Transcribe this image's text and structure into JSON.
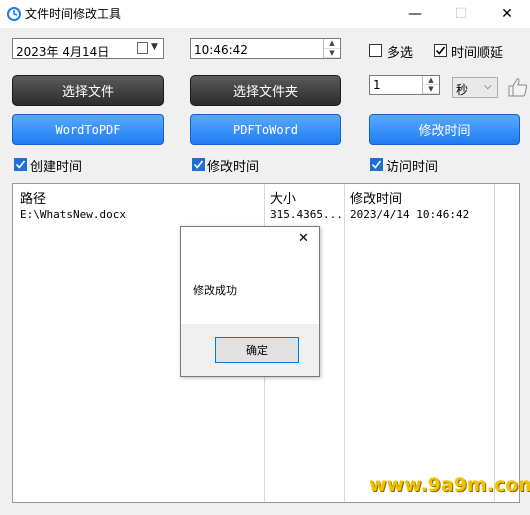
{
  "window": {
    "title": "文件时间修改工具",
    "minimize": "—",
    "maximize": "☐",
    "close": "✕"
  },
  "date_field": {
    "value": "2023年  4月14日"
  },
  "time_field": {
    "value": "10:46:42"
  },
  "options": {
    "multi_select": "多选",
    "time_order": "时间顺延"
  },
  "step": {
    "value": "1",
    "unit": "秒"
  },
  "buttons": {
    "select_file": "选择文件",
    "select_folder": "选择文件夹",
    "word_to_pdf": "WordToPDF",
    "pdf_to_word": "PDFToWord",
    "modify_time": "修改时间"
  },
  "checks": {
    "create_time": "创建时间",
    "modify_time": "修改时间",
    "access_time": "访问时间"
  },
  "table": {
    "headers": [
      "路径",
      "大小",
      "修改时间"
    ],
    "rows": [
      {
        "path": "E:\\WhatsNew.docx",
        "size": "315.4365...",
        "mtime": "2023/4/14 10:46:42"
      }
    ]
  },
  "dialog": {
    "message": "修改成功",
    "ok": "确定",
    "close": "✕"
  },
  "watermark": "www.9a9m.com",
  "colors": {
    "blue_button": "#1f7df2",
    "dark_button": "#2c2c2c",
    "checkbox_blue": "#1f6fd6"
  }
}
